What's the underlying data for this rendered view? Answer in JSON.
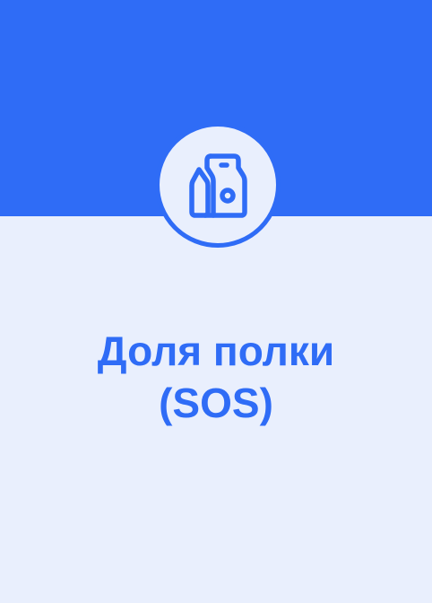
{
  "card": {
    "title_line1": "Доля полки",
    "title_line2": "(SOS)",
    "icon": "product-package-icon"
  },
  "colors": {
    "accent": "#2f6cf6",
    "background": "#e9effd"
  }
}
